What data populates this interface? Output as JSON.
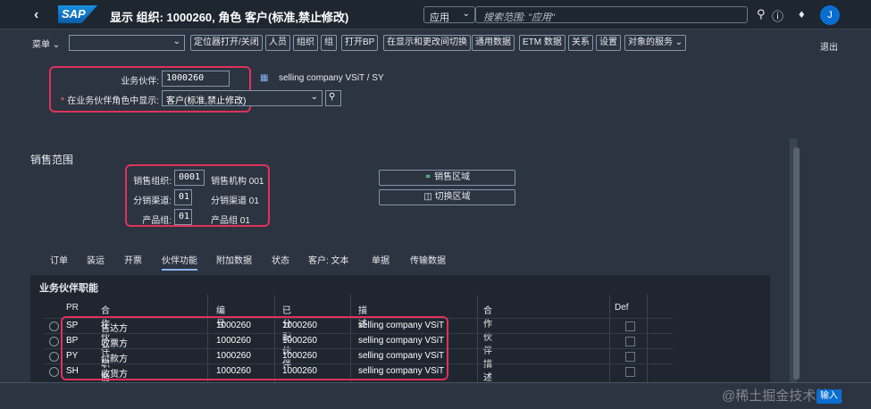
{
  "shell": {
    "logo": "SAP",
    "title": "显示 组织: 1000260, 角色 客户(标准,禁止修改)",
    "scope": "应用",
    "search_placeholder": "搜索范围: \"应用\"",
    "avatar": "J"
  },
  "toolbar": {
    "menu": "菜单",
    "buttons": [
      "定位器打开/关闭",
      "人员",
      "组织",
      "组",
      "打开BP",
      "在显示和更改间切换",
      "通用数据",
      "ETM 数据",
      "关系",
      "设置",
      "对象的服务"
    ],
    "exit": "退出"
  },
  "header": {
    "partner_label": "业务伙伴:",
    "partner_value": "1000260",
    "partner_desc": "selling company VSiT / SY",
    "role_label": "在业务伙伴角色中显示:",
    "role_value": "客户(标准,禁止修改)"
  },
  "sales": {
    "title": "销售范围",
    "org_label": "销售组织:",
    "org_value": "0001",
    "org_desc": "销售机构 001",
    "channel_label": "分销渠道:",
    "channel_value": "01",
    "channel_desc": "分销渠道 01",
    "division_label": "产品组:",
    "division_value": "01",
    "division_desc": "产品组 01",
    "area_btn": "销售区域",
    "switch_btn": "切换区域"
  },
  "tabs": [
    "订单",
    "装运",
    "开票",
    "伙伴功能",
    "附加数据",
    "状态",
    "客户: 文本",
    "单据",
    "传输数据"
  ],
  "partner_functions": {
    "title": "业务伙伴职能",
    "columns": [
      "PR",
      "合作伙伴职能",
      "编号",
      "已分配伙伴",
      "描述",
      "合作伙伴描述",
      "Def"
    ],
    "rows": [
      {
        "pr": "SP",
        "func": "售达方",
        "num": "1000260",
        "assigned": "1000260",
        "desc": "selling company VSiT"
      },
      {
        "pr": "BP",
        "func": "收票方",
        "num": "1000260",
        "assigned": "1000260",
        "desc": "selling company VSiT"
      },
      {
        "pr": "PY",
        "func": "付款方",
        "num": "1000260",
        "assigned": "1000260",
        "desc": "selling company VSiT"
      },
      {
        "pr": "SH",
        "func": "收货方",
        "num": "1000260",
        "assigned": "1000260",
        "desc": "selling company VSiT"
      }
    ]
  },
  "footer": {
    "enter": "输入",
    "watermark": "@稀土掘金技术社区"
  },
  "colors": {
    "accent": "#0a6ed1",
    "highlight": "#e0315a"
  }
}
